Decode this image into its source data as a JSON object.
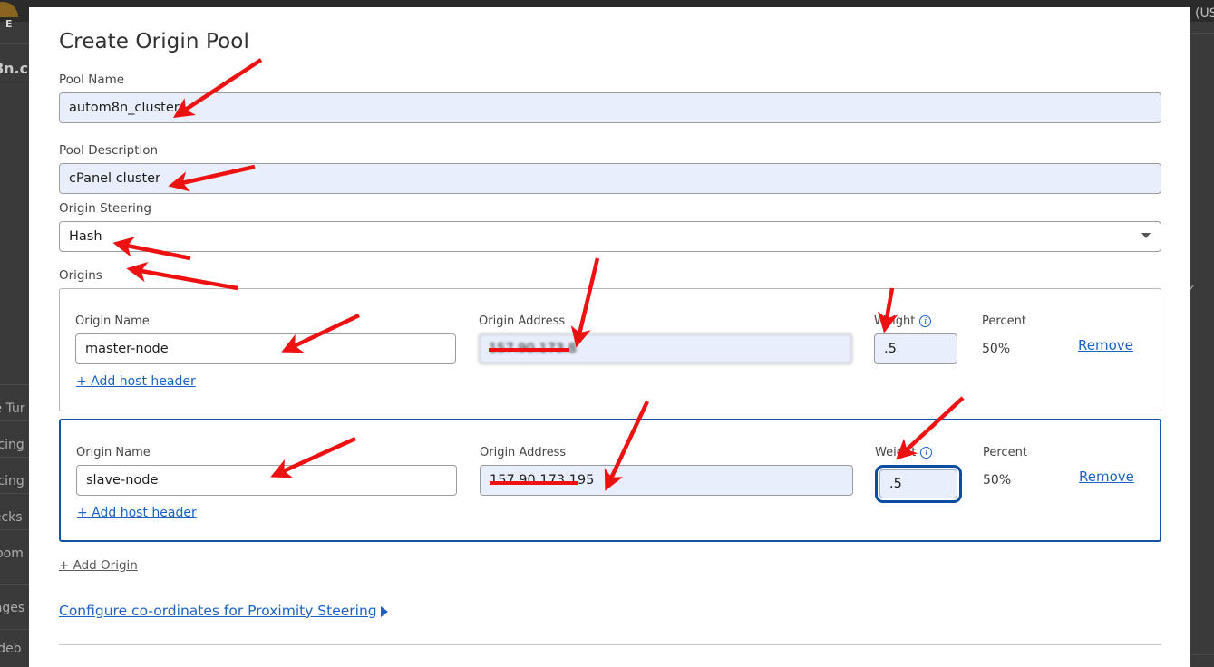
{
  "background": {
    "logo_text": "E",
    "domain_fragment": "8n.c",
    "right_fragment": "(US",
    "nav_fragments": [
      "re Tur",
      "ancing",
      "ancing",
      "necks",
      "Room",
      "Pages",
      "sideb"
    ]
  },
  "modal": {
    "title": "Create Origin Pool",
    "pool_name": {
      "label": "Pool Name",
      "value": "autom8n_cluster"
    },
    "pool_description": {
      "label": "Pool Description",
      "value": "cPanel cluster"
    },
    "origin_steering": {
      "label": "Origin Steering",
      "value": "Hash"
    },
    "origins": {
      "label": "Origins",
      "column_labels": {
        "name": "Origin Name",
        "address": "Origin Address",
        "weight": "Weight",
        "percent": "Percent"
      },
      "add_host_header_label": "+ Add host header",
      "remove_label": "Remove",
      "items": [
        {
          "name": "master-node",
          "address": "157.90.173.8",
          "weight": ".5",
          "percent": "50%",
          "selected": false
        },
        {
          "name": "slave-node",
          "address": "157.90.173.195",
          "weight": ".5",
          "percent": "50%",
          "selected": true
        }
      ]
    },
    "add_origin_label": "+ Add Origin",
    "proximity_link_label": "Configure co-ordinates for Proximity Steering"
  },
  "colors": {
    "accent_link": "#1a63c4",
    "focus_blue": "#0b4da2",
    "autofill_bg": "#e8eefc",
    "annotation_red": "#ee1111"
  }
}
